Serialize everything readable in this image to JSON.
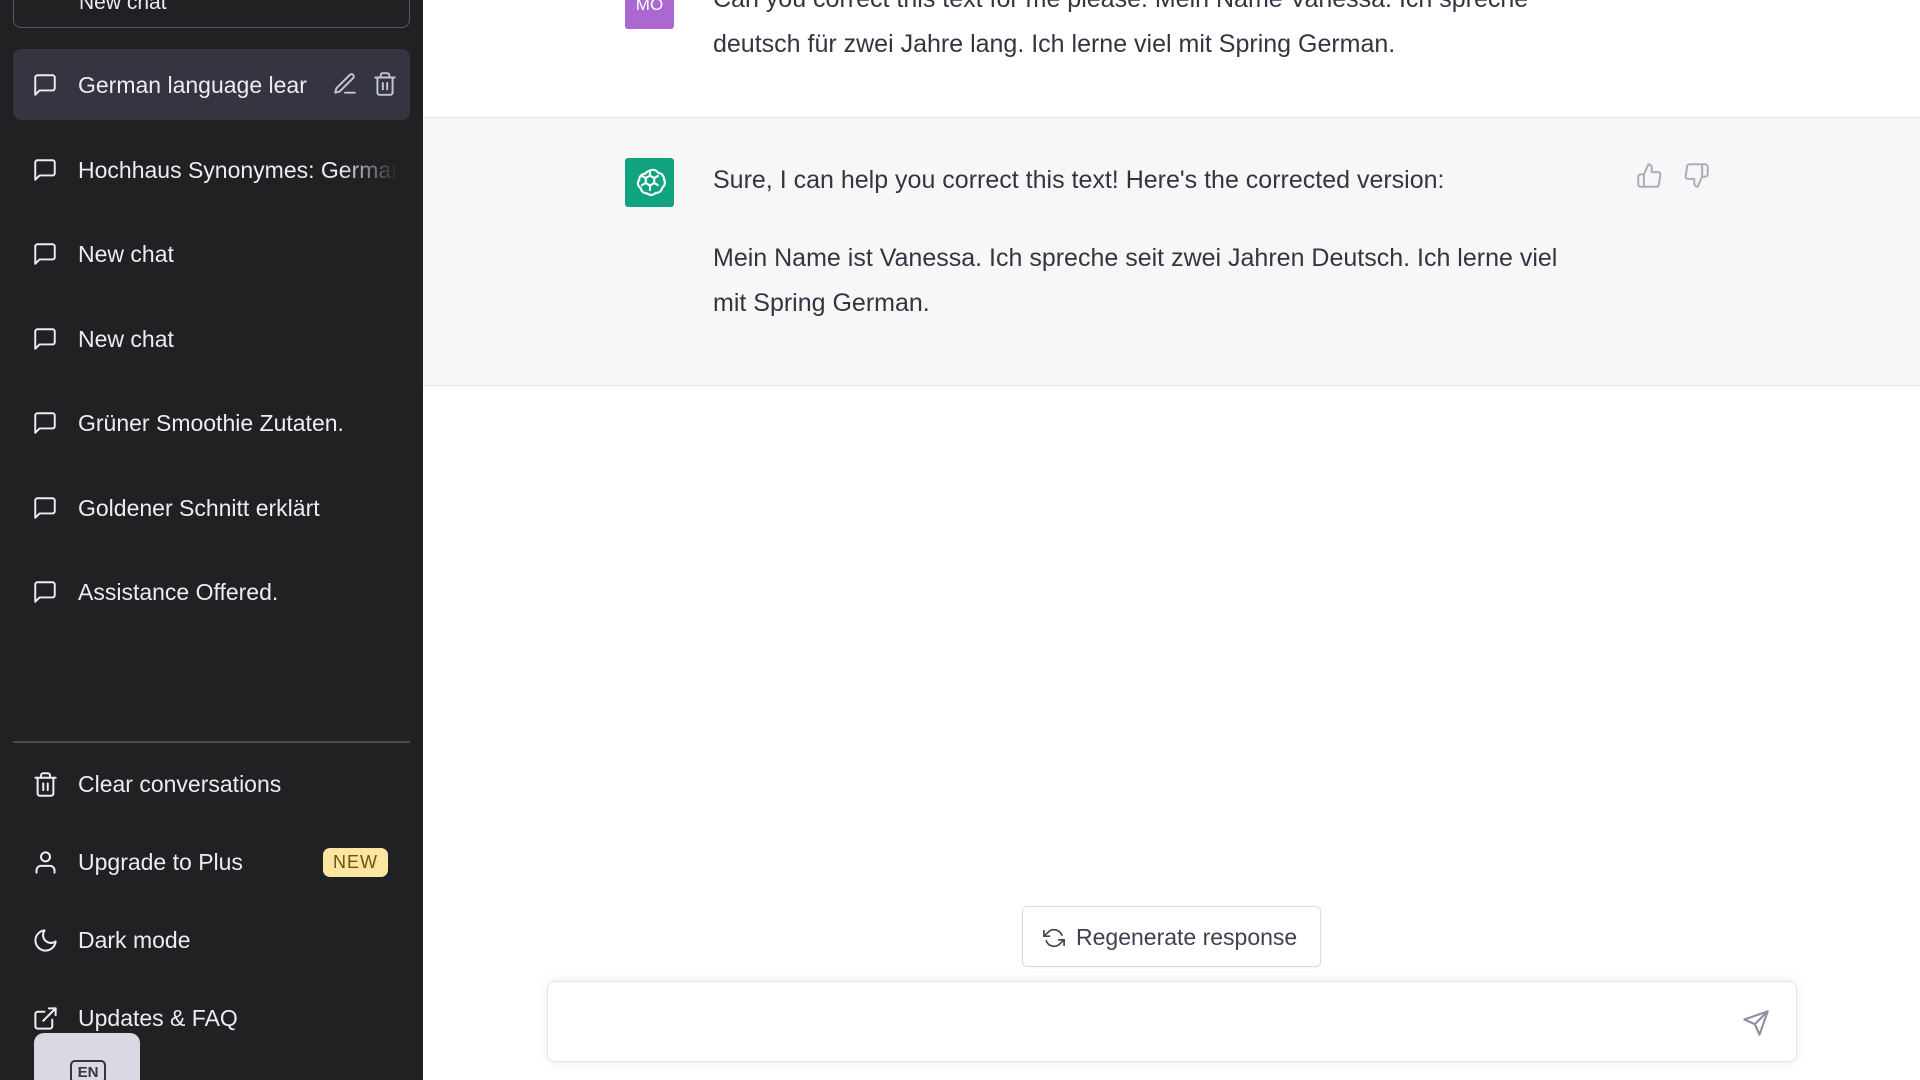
{
  "sidebar": {
    "new_chat_label": "New chat",
    "chats": [
      {
        "label": "German language lear",
        "active": true
      },
      {
        "label": "Hochhaus Synonymes: German"
      },
      {
        "label": "New chat"
      },
      {
        "label": "New chat"
      },
      {
        "label": "Grüner Smoothie Zutaten."
      },
      {
        "label": "Goldener Schnitt erklärt"
      },
      {
        "label": "Assistance Offered."
      }
    ],
    "bottom": {
      "clear": "Clear conversations",
      "upgrade": "Upgrade to Plus",
      "upgrade_badge": "NEW",
      "dark_mode": "Dark mode",
      "updates": "Updates & FAQ"
    },
    "lang_tab": "EN"
  },
  "conversation": {
    "user": {
      "avatar": "MO",
      "text_line1": "Can you correct this text for me please. Mein Name Vanessa. Ich spreche",
      "text_line2": "deutsch für zwei Jahre lang. Ich lerne viel mit Spring German."
    },
    "assistant": {
      "line1": "Sure, I can help you correct this text! Here's the corrected version:",
      "line2a": "Mein Name ist Vanessa. Ich spreche seit zwei Jahren Deutsch. Ich lerne viel",
      "line2b": "mit Spring German."
    }
  },
  "regenerate_label": "Regenerate response",
  "composer": {
    "value": "",
    "placeholder": ""
  },
  "colors": {
    "sidebar_bg": "#202123",
    "assistant_avatar": "#10a37f",
    "user_avatar": "#ab68d0",
    "badge_bg": "#fae69e"
  },
  "icons": [
    "chat-bubble-icon",
    "edit-icon",
    "trash-icon",
    "user-icon",
    "moon-icon",
    "external-link-icon",
    "thumbs-up-icon",
    "thumbs-down-icon",
    "refresh-icon",
    "send-icon",
    "openai-logo-icon"
  ]
}
